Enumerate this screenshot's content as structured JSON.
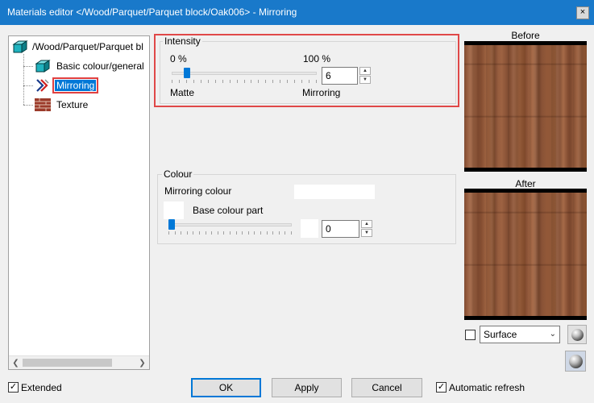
{
  "window": {
    "title": "Materials editor  </Wood/Parquet/Parquet block/Oak006> - Mirroring",
    "close_glyph": "×"
  },
  "tree": {
    "root_label": "/Wood/Parquet/Parquet bl",
    "items": [
      {
        "label": "Basic colour/general",
        "icon": "cube-icon"
      },
      {
        "label": "Mirroring",
        "icon": "mirroring-icon",
        "selected": true
      },
      {
        "label": "Texture",
        "icon": "brick-texture-icon"
      }
    ],
    "scroll_left": "❮",
    "scroll_right": "❯"
  },
  "intensity": {
    "legend": "Intensity",
    "min_label": "0 %",
    "max_label": "100 %",
    "left_caption": "Matte",
    "right_caption": "Mirroring",
    "value": "6",
    "slider_fraction": 0.06
  },
  "colour": {
    "legend": "Colour",
    "mirroring_colour_label": "Mirroring colour",
    "base_colour_part_label": "Base colour part",
    "value": "0",
    "slider_fraction": 0.0
  },
  "preview": {
    "before_label": "Before",
    "after_label": "After",
    "surface_select": "Surface",
    "surface_checked": false
  },
  "footer": {
    "extended_label": "Extended",
    "extended_checked": true,
    "ok_label": "OK",
    "apply_label": "Apply",
    "cancel_label": "Cancel",
    "auto_refresh_label": "Automatic refresh",
    "auto_refresh_checked": true,
    "check_glyph": "✓"
  },
  "spin": {
    "up_glyph": "▲",
    "down_glyph": "▼"
  },
  "colors": {
    "titlebar": "#1979ca",
    "accent": "#0078d7",
    "highlight": "#e04848"
  }
}
